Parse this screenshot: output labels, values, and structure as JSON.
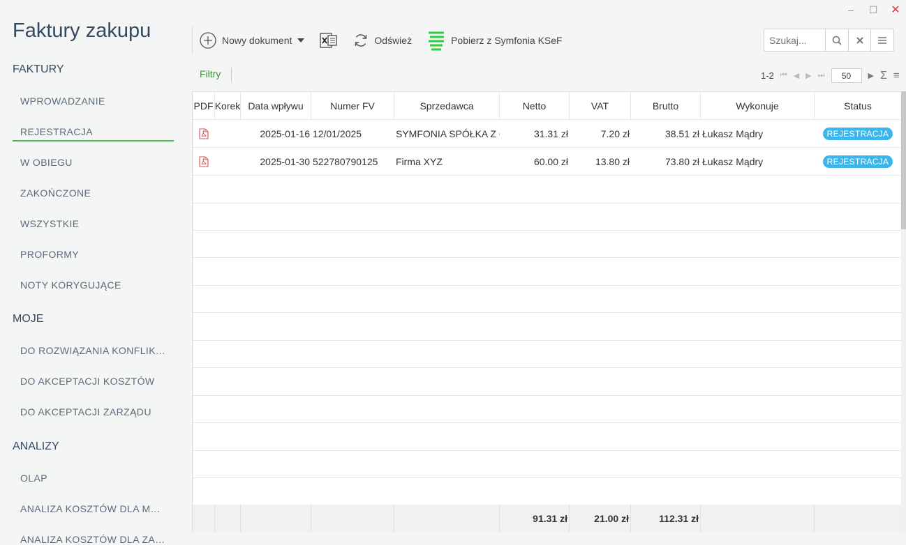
{
  "window": {
    "minimize": "–",
    "maximize": "☐",
    "close": "✕"
  },
  "app_title": "Faktury zakupu",
  "sidebar": {
    "sections": [
      {
        "title": "FAKTURY",
        "items": [
          "WPROWADZANIE",
          "REJESTRACJA",
          "W OBIEGU",
          "ZAKOŃCZONE",
          "WSZYSTKIE",
          "PROFORMY",
          "NOTY KORYGUJĄCE"
        ]
      },
      {
        "title": "MOJE",
        "items": [
          "DO ROZWIĄZANIA KONFLIK…",
          "DO AKCEPTACJI KOSZTÓW",
          "DO AKCEPTACJI ZARZĄDU"
        ]
      },
      {
        "title": "ANALIZY",
        "items": [
          "OLAP",
          "ANALIZA KOSZTÓW DLA M…",
          "ANALIZA KOSZTÓW DLA ZA…"
        ]
      }
    ],
    "active_item": "REJESTRACJA"
  },
  "toolbar": {
    "new_doc_label": "Nowy dokument",
    "refresh_label": "Odśwież",
    "ksef_label": "Pobierz z Symfonia KSeF"
  },
  "search": {
    "placeholder": "Szukaj..."
  },
  "filters_label": "Filtry",
  "pager": {
    "range": "1-2",
    "page_size": "50"
  },
  "grid": {
    "columns": [
      "PDF",
      "Korek",
      "Data wpływu",
      "Numer FV",
      "Sprzedawca",
      "Netto",
      "VAT",
      "Brutto",
      "Wykonuje",
      "Status"
    ],
    "rows": [
      {
        "date": "2025-01-16",
        "number": "12/01/2025",
        "seller": "SYMFONIA SPÓŁKA Z O.O.",
        "netto": "31.31 zł",
        "vat": "7.20 zł",
        "brutto": "38.51 zł",
        "assignee": "Łukasz Mądry",
        "status": "REJESTRACJA"
      },
      {
        "date": "2025-01-30",
        "number": "522780790125",
        "seller": "Firma XYZ",
        "netto": "60.00 zł",
        "vat": "13.80 zł",
        "brutto": "73.80 zł",
        "assignee": "Łukasz Mądry",
        "status": "REJESTRACJA"
      }
    ],
    "totals": {
      "netto": "91.31 zł",
      "vat": "21.00 zł",
      "brutto": "112.31 zł"
    }
  },
  "colors": {
    "accent_green": "#4caf50",
    "badge_blue": "#3bb5ea",
    "title": "#34495e"
  }
}
